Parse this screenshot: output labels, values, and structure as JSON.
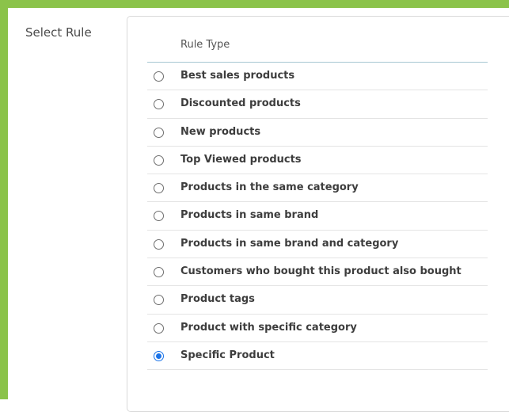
{
  "field": {
    "label": "Select Rule"
  },
  "table": {
    "header": "Rule Type",
    "selected_index": 10,
    "options": [
      "Best sales products",
      "Discounted products",
      "New products",
      "Top Viewed products",
      "Products in the same category",
      "Products in same brand",
      "Products in same brand and category",
      "Customers who bought this product also bought",
      "Product tags",
      "Product with specific category",
      "Specific Product"
    ]
  },
  "colors": {
    "frame_accent": "#8bc34a",
    "radio_checked": "#1a73e8"
  }
}
